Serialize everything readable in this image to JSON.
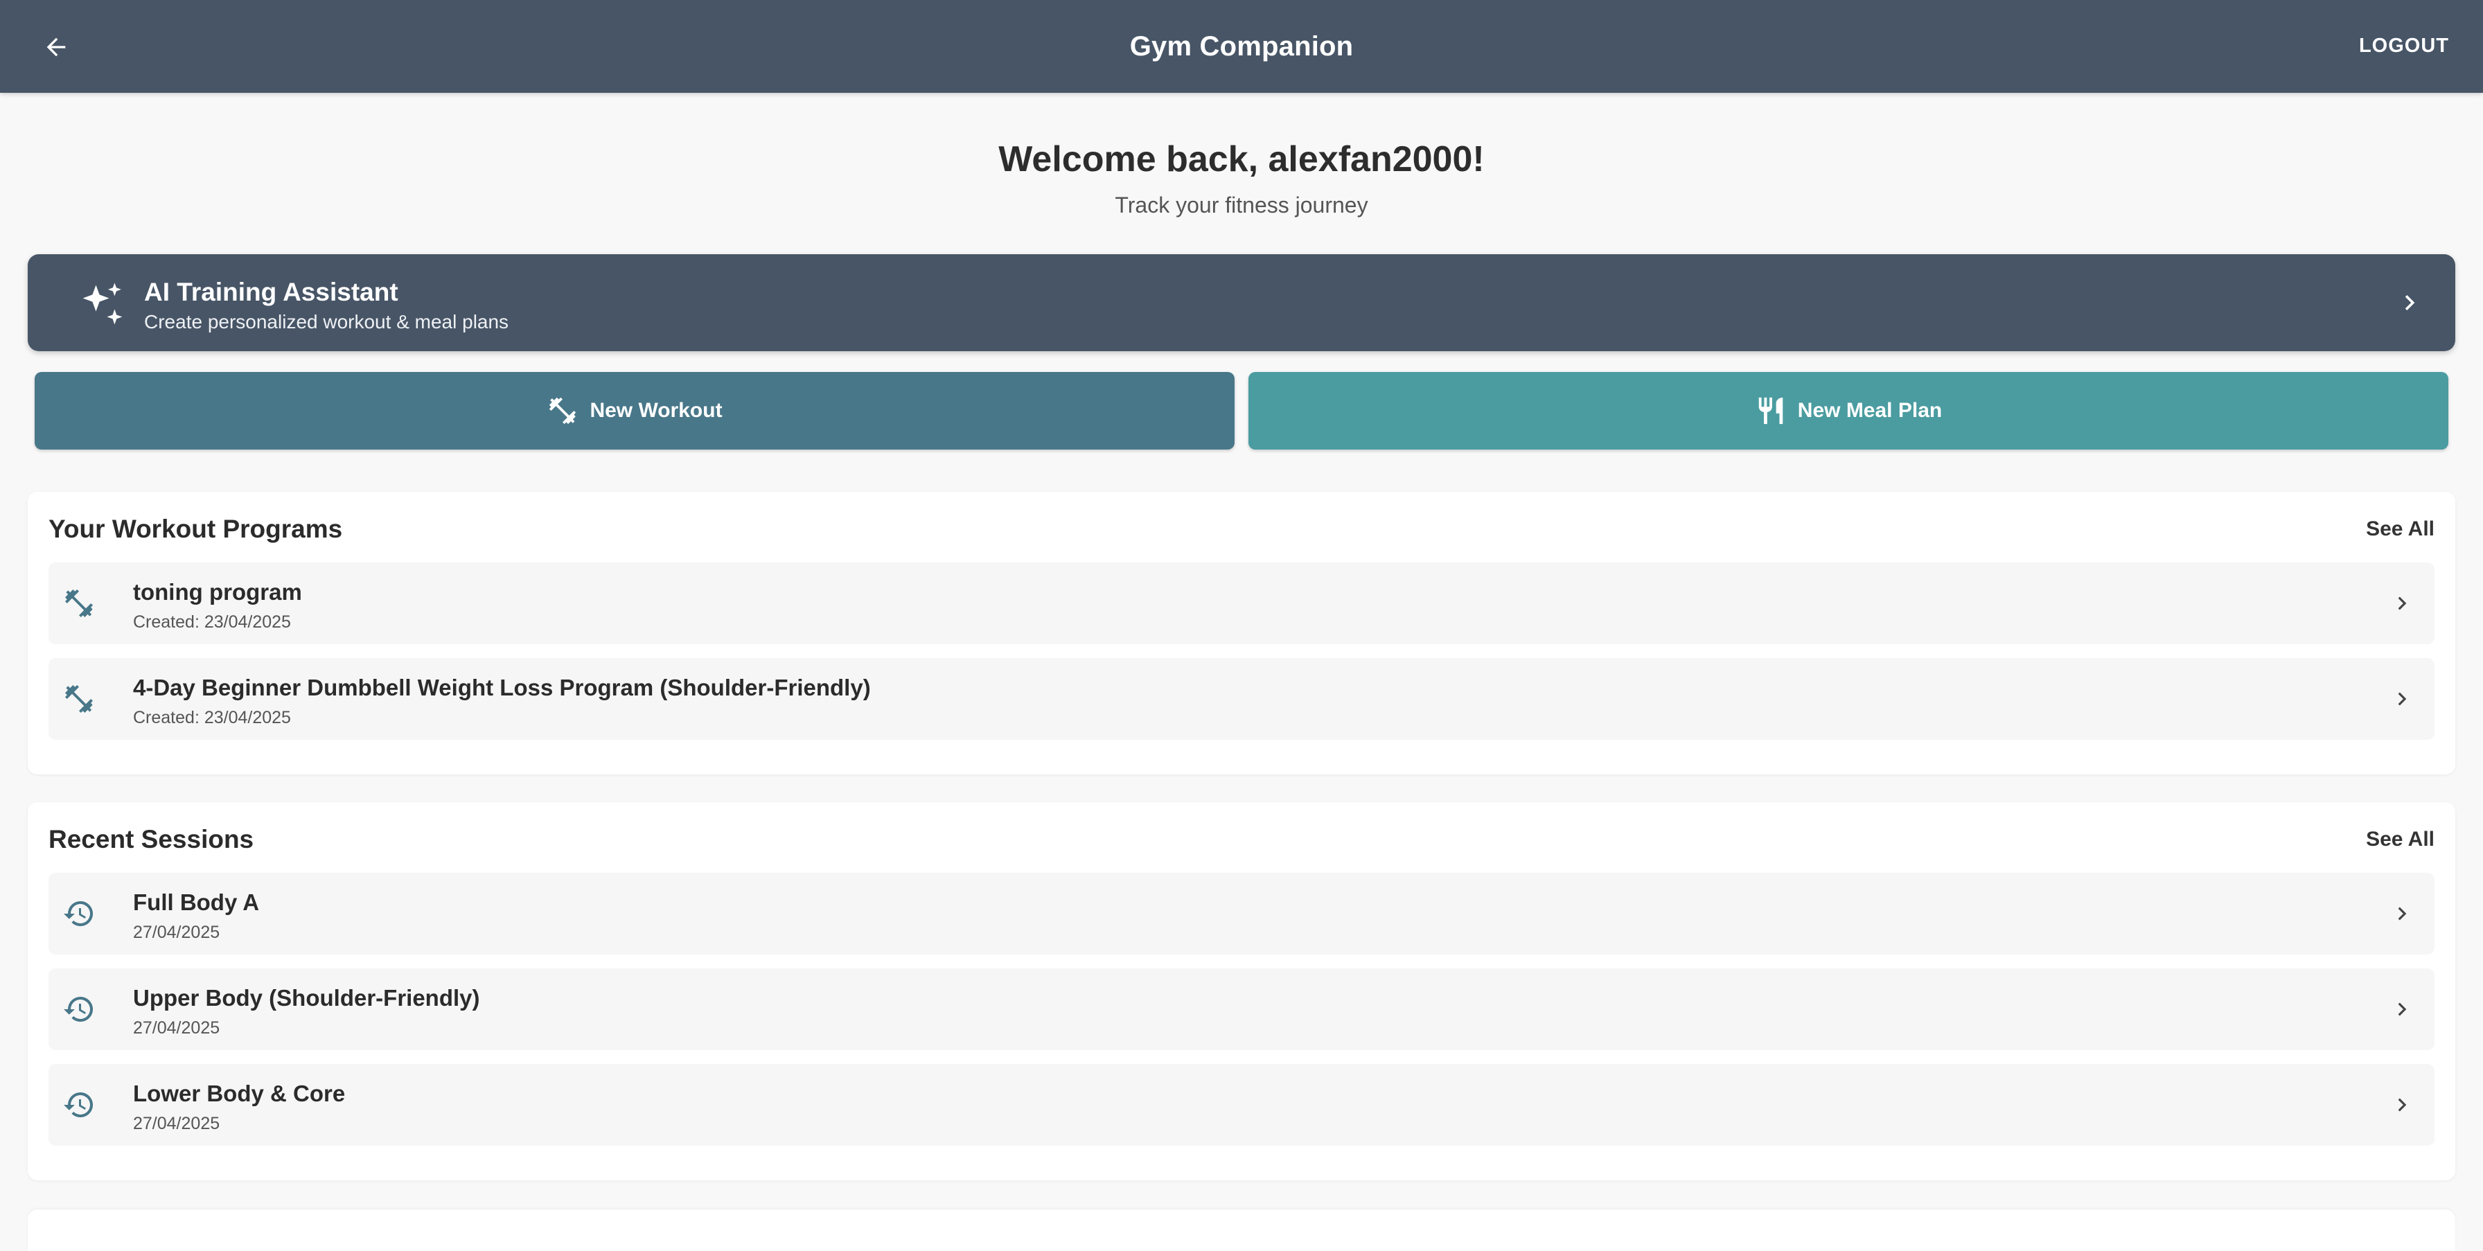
{
  "appbar": {
    "title": "Gym Companion",
    "logout_label": "LOGOUT"
  },
  "welcome": {
    "heading": "Welcome back, alexfan2000!",
    "subheading": "Track your fitness journey"
  },
  "ai_banner": {
    "title": "AI Training Assistant",
    "subtitle": "Create personalized workout & meal plans"
  },
  "actions": {
    "new_workout": "New Workout",
    "new_meal_plan": "New Meal Plan"
  },
  "programs": {
    "heading": "Your Workout Programs",
    "see_all": "See All",
    "items": [
      {
        "name": "toning program",
        "created": "Created: 23/04/2025"
      },
      {
        "name": "4-Day Beginner Dumbbell Weight Loss Program (Shoulder-Friendly)",
        "created": "Created: 23/04/2025"
      }
    ]
  },
  "sessions": {
    "heading": "Recent Sessions",
    "see_all": "See All",
    "items": [
      {
        "name": "Full Body A",
        "date": "27/04/2025"
      },
      {
        "name": "Upper Body (Shoulder-Friendly)",
        "date": "27/04/2025"
      },
      {
        "name": "Lower Body & Core",
        "date": "27/04/2025"
      }
    ]
  },
  "colors": {
    "appbar": "#475566",
    "workout_button": "#487789",
    "meal_button": "#4a9ca0",
    "icon_accent": "#487789"
  }
}
